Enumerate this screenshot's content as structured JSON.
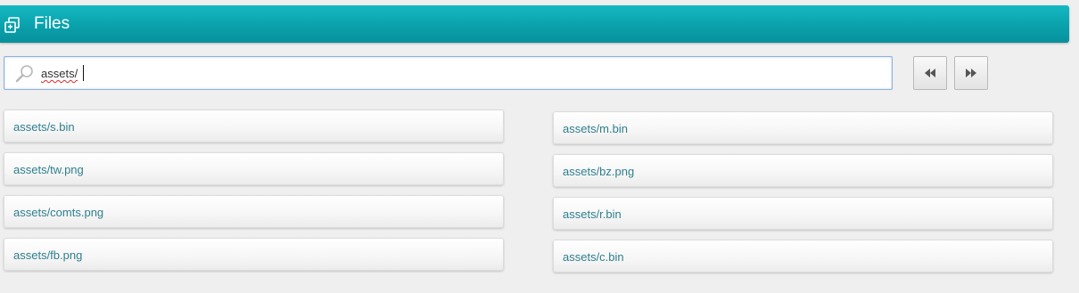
{
  "header": {
    "title": "Files",
    "icon": "files-icon"
  },
  "search": {
    "value": "assets/",
    "icon": "search-icon"
  },
  "pager": {
    "prev_icon": "rewind-icon",
    "next_icon": "fast-forward-icon"
  },
  "files": {
    "left": [
      "assets/s.bin",
      "assets/tw.png",
      "assets/comts.png",
      "assets/fb.png"
    ],
    "right": [
      "assets/m.bin",
      "assets/bz.png",
      "assets/r.bin",
      "assets/c.bin"
    ]
  },
  "colors": {
    "header": "#0aa1ac",
    "link": "#2f7f8f",
    "background": "#efefef"
  }
}
